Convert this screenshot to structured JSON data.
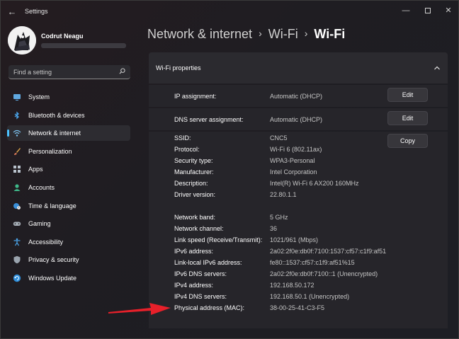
{
  "window": {
    "app_title": "Settings",
    "back_glyph": "←",
    "minimize_glyph": "—",
    "close_glyph": "✕"
  },
  "profile": {
    "name": "Codrut Neagu"
  },
  "search": {
    "placeholder": "Find a setting"
  },
  "sidebar": {
    "accent": "#4cc2ff",
    "items": [
      {
        "label": "System",
        "icon": "monitor-icon",
        "active": false
      },
      {
        "label": "Bluetooth & devices",
        "icon": "bluetooth-icon",
        "active": false
      },
      {
        "label": "Network & internet",
        "icon": "wifi-icon",
        "active": true
      },
      {
        "label": "Personalization",
        "icon": "brush-icon",
        "active": false
      },
      {
        "label": "Apps",
        "icon": "apps-icon",
        "active": false
      },
      {
        "label": "Accounts",
        "icon": "person-icon",
        "active": false
      },
      {
        "label": "Time & language",
        "icon": "globe-clock-icon",
        "active": false
      },
      {
        "label": "Gaming",
        "icon": "gamepad-icon",
        "active": false
      },
      {
        "label": "Accessibility",
        "icon": "accessibility-icon",
        "active": false
      },
      {
        "label": "Privacy & security",
        "icon": "shield-icon",
        "active": false
      },
      {
        "label": "Windows Update",
        "icon": "update-icon",
        "active": false
      }
    ]
  },
  "breadcrumb": {
    "items": [
      "Network & internet",
      "Wi-Fi",
      "Wi-Fi"
    ],
    "separator": "›"
  },
  "panel": {
    "title": "Wi-Fi properties",
    "ip_assignment": {
      "label": "IP assignment:",
      "value": "Automatic (DHCP)",
      "button": "Edit"
    },
    "dns_assignment": {
      "label": "DNS server assignment:",
      "value": "Automatic (DHCP)",
      "button": "Edit"
    },
    "copy_button": "Copy",
    "details": [
      {
        "label": "SSID:",
        "value": "CNC5"
      },
      {
        "label": "Protocol:",
        "value": "Wi-Fi 6 (802.11ax)"
      },
      {
        "label": "Security type:",
        "value": "WPA3-Personal"
      },
      {
        "label": "Manufacturer:",
        "value": "Intel Corporation"
      },
      {
        "label": "Description:",
        "value": "Intel(R) Wi-Fi 6 AX200 160MHz"
      },
      {
        "label": "Driver version:",
        "value": "22.80.1.1"
      },
      {
        "label": "Network band:",
        "value": "5 GHz"
      },
      {
        "label": "Network channel:",
        "value": "36"
      },
      {
        "label": "Link speed (Receive/Transmit):",
        "value": "1021/961 (Mbps)"
      },
      {
        "label": "IPv6 address:",
        "value": "2a02:2f0e:db0f:7100:1537:cf57:c1f9:af51"
      },
      {
        "label": "Link-local IPv6 address:",
        "value": "fe80::1537:cf57:c1f9:af51%15"
      },
      {
        "label": "IPv6 DNS servers:",
        "value": "2a02:2f0e:db0f:7100::1 (Unencrypted)"
      },
      {
        "label": "IPv4 address:",
        "value": "192.168.50.172"
      },
      {
        "label": "IPv4 DNS servers:",
        "value": "192.168.50.1 (Unencrypted)"
      },
      {
        "label": "Physical address (MAC):",
        "value": "38-00-25-41-C3-F5"
      }
    ]
  },
  "annotation": {
    "color": "#e8202a"
  }
}
